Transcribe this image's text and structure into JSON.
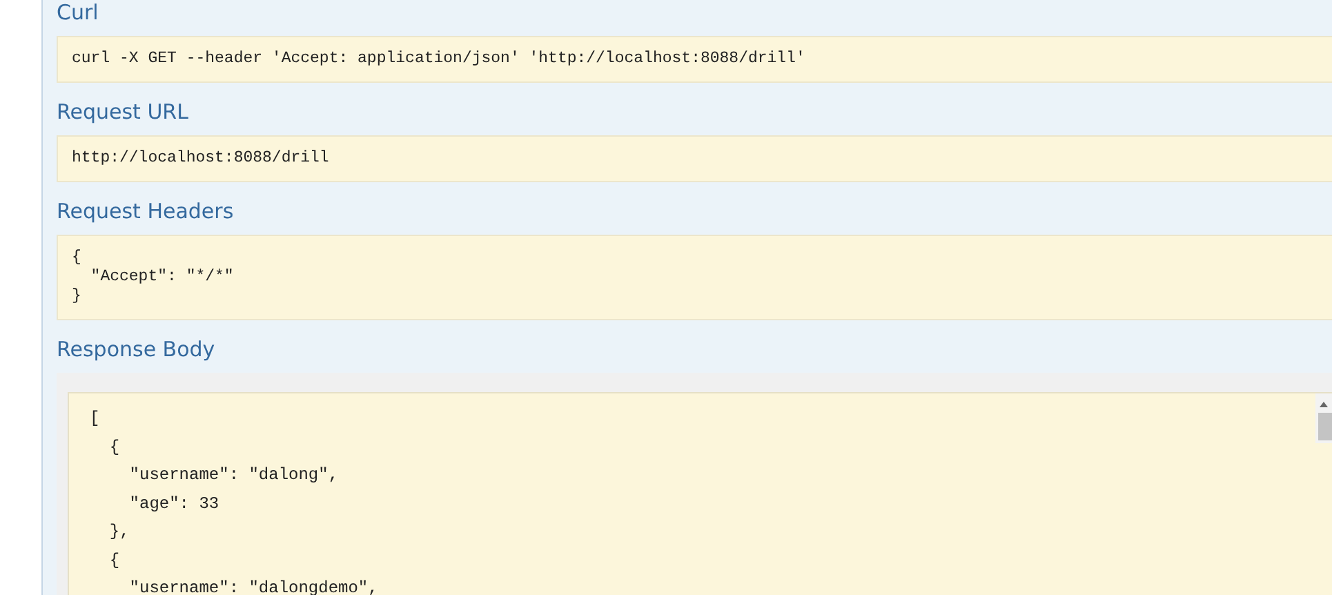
{
  "sections": [
    {
      "kind": "code",
      "title": "Curl",
      "text": "curl -X GET --header 'Accept: application/json' 'http://localhost:8088/drill'"
    },
    {
      "kind": "code",
      "title": "Request URL",
      "text": "http://localhost:8088/drill"
    },
    {
      "kind": "code",
      "title": "Request Headers",
      "text": "{\n  \"Accept\": \"*/*\"\n}"
    },
    {
      "kind": "response",
      "title": "Response Body",
      "text": "[\n  {\n    \"username\": \"dalong\",\n    \"age\": 33\n  },\n  {\n    \"username\": \"dalongdemo\","
    }
  ]
}
